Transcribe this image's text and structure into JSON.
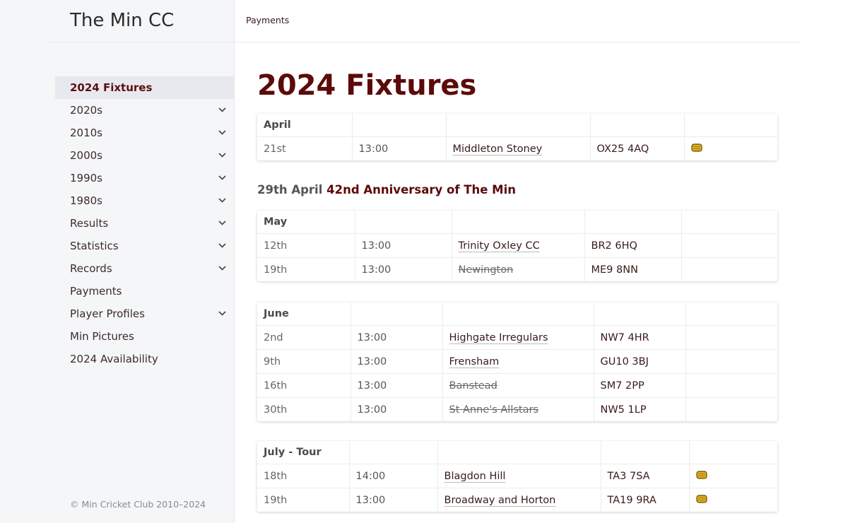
{
  "site": {
    "title": "The Min CC",
    "copyright": "© Min Cricket Club 2010–2024"
  },
  "topbar": {
    "link": "Payments"
  },
  "sidebar": {
    "items": [
      {
        "label": "2024 Fixtures",
        "active": true,
        "expandable": false
      },
      {
        "label": "2020s",
        "expandable": true
      },
      {
        "label": "2010s",
        "expandable": true
      },
      {
        "label": "2000s",
        "expandable": true
      },
      {
        "label": "1990s",
        "expandable": true
      },
      {
        "label": "1980s",
        "expandable": true
      },
      {
        "label": "Results",
        "expandable": true
      },
      {
        "label": "Statistics",
        "expandable": true
      },
      {
        "label": "Records",
        "expandable": true
      },
      {
        "label": "Payments",
        "expandable": false
      },
      {
        "label": "Player Profiles",
        "expandable": true
      },
      {
        "label": "Min Pictures",
        "expandable": false
      },
      {
        "label": "2024 Availability",
        "expandable": false
      }
    ]
  },
  "page": {
    "title": "2024 Fixtures"
  },
  "anniversary": {
    "date": "29th April",
    "title": "42nd Anniversary of The Min"
  },
  "months": [
    {
      "name": "April",
      "rows": [
        {
          "date": "21st",
          "time": "13:00",
          "venue": "Middleton Stoney",
          "postcode": "OX25 4AQ",
          "cancelled": false,
          "icon": "bread-icon"
        }
      ]
    },
    {
      "name": "May",
      "rows": [
        {
          "date": "12th",
          "time": "13:00",
          "venue": "Trinity Oxley CC",
          "postcode": "BR2 6HQ",
          "cancelled": false,
          "icon": ""
        },
        {
          "date": "19th",
          "time": "13:00",
          "venue": "Newington",
          "postcode": "ME9 8NN",
          "cancelled": true,
          "icon": ""
        }
      ]
    },
    {
      "name": "June",
      "rows": [
        {
          "date": "2nd",
          "time": "13:00",
          "venue": "Highgate Irregulars",
          "postcode": "NW7 4HR",
          "cancelled": false,
          "icon": ""
        },
        {
          "date": "9th",
          "time": "13:00",
          "venue": "Frensham",
          "postcode": "GU10 3BJ",
          "cancelled": false,
          "icon": ""
        },
        {
          "date": "16th",
          "time": "13:00",
          "venue": "Banstead",
          "postcode": "SM7 2PP",
          "cancelled": true,
          "icon": ""
        },
        {
          "date": "30th",
          "time": "13:00",
          "venue": "St Anne's Allstars",
          "postcode": "NW5 1LP",
          "cancelled": true,
          "icon": ""
        }
      ]
    },
    {
      "name": "July - Tour",
      "rows": [
        {
          "date": "18th",
          "time": "14:00",
          "venue": "Blagdon Hill",
          "postcode": "TA3 7SA",
          "cancelled": false,
          "icon": "bread-icon"
        },
        {
          "date": "19th",
          "time": "13:00",
          "venue": "Broadway and Horton",
          "postcode": "TA19 9RA",
          "cancelled": false,
          "icon": "bread-icon"
        }
      ]
    }
  ],
  "colors": {
    "accent": "#5c0a0a",
    "sidebar_bg": "#f5f6f8",
    "active_bg": "#e8e9ef"
  }
}
